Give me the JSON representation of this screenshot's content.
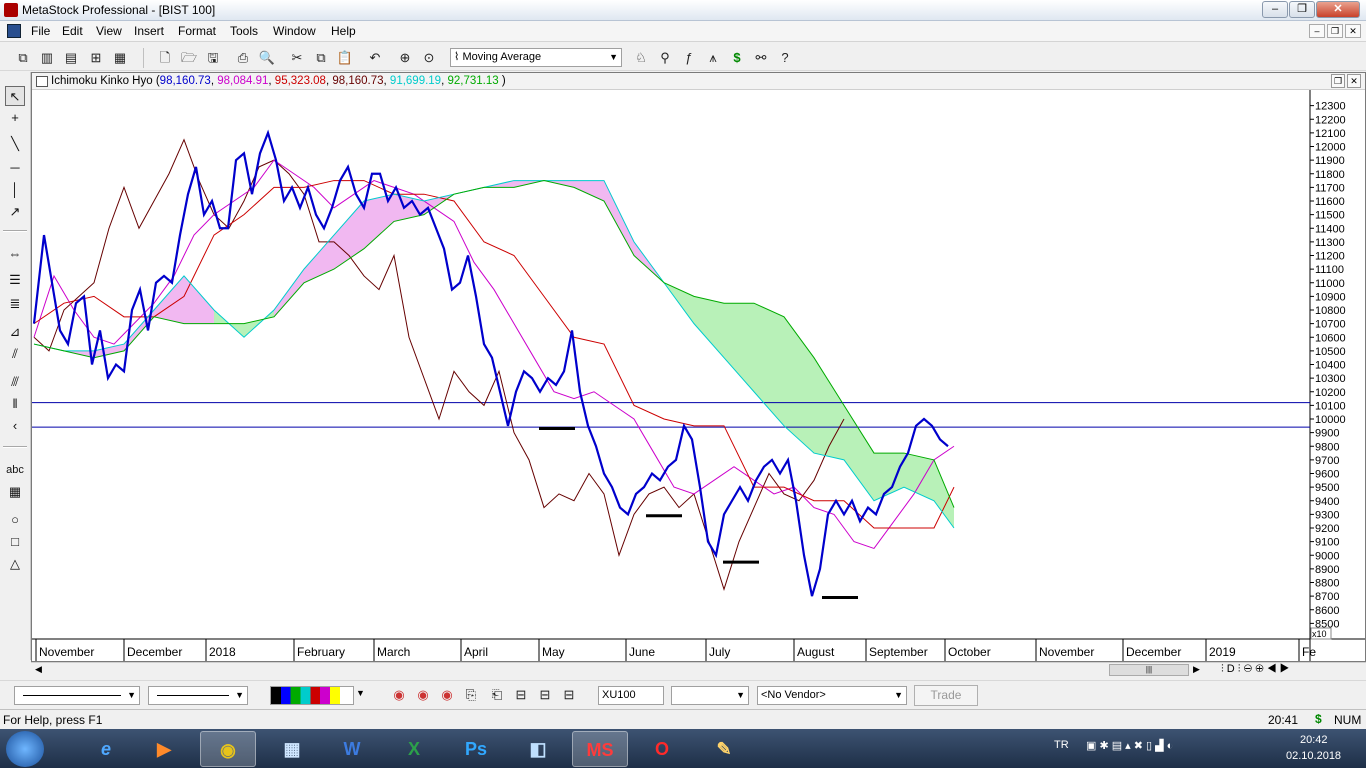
{
  "window": {
    "title": "MetaStock Professional - [BIST 100]",
    "buttons": {
      "minimize": "–",
      "restore": "❐",
      "close": "✕"
    }
  },
  "menu": {
    "items": [
      "File",
      "Edit",
      "View",
      "Insert",
      "Format",
      "Tools",
      "Window",
      "Help"
    ],
    "mdi": {
      "minimize": "–",
      "restore": "❐",
      "close": "✕"
    }
  },
  "toolbar": {
    "indicator_select": "Moving Average"
  },
  "chart": {
    "indicator_name": "Ichimoku Kinko Hyo",
    "values": [
      {
        "text": "98,160.73",
        "color": "#0000cc"
      },
      {
        "text": "98,084.91",
        "color": "#cc00cc"
      },
      {
        "text": "95,323.08",
        "color": "#cc0000"
      },
      {
        "text": "98,160.73",
        "color": "#660000"
      },
      {
        "text": "91,699.19",
        "color": "#00cccc"
      },
      {
        "text": "92,731.13",
        "color": "#00aa00"
      }
    ],
    "scale_label": "x10"
  },
  "chart_data": {
    "type": "line",
    "ylim": [
      8400,
      12400
    ],
    "yticks": [
      8500,
      8600,
      8700,
      8800,
      8900,
      9000,
      9100,
      9200,
      9300,
      9400,
      9500,
      9600,
      9700,
      9800,
      9900,
      10000,
      10100,
      10200,
      10300,
      10400,
      10500,
      10600,
      10700,
      10800,
      10900,
      11000,
      11100,
      11200,
      11300,
      11400,
      11500,
      11600,
      11700,
      11800,
      11900,
      12000,
      12100,
      12200,
      12300
    ],
    "xlabels": [
      "November",
      "December",
      "2018",
      "February",
      "March",
      "April",
      "May",
      "June",
      "July",
      "August",
      "September",
      "October",
      "November",
      "December",
      "2019",
      "Fe"
    ],
    "xlabel_positions": [
      4,
      92,
      174,
      262,
      342,
      429,
      507,
      594,
      674,
      762,
      834,
      913,
      1004,
      1091,
      1174,
      1267
    ],
    "horizontal_lines": [
      10120,
      9940
    ],
    "support_marks": [
      {
        "x": 525,
        "y": 9930
      },
      {
        "x": 632,
        "y": 9290
      },
      {
        "x": 709,
        "y": 8950
      },
      {
        "x": 808,
        "y": 8690
      }
    ],
    "series": [
      {
        "color": "#0000cc",
        "x": [
          0,
          10,
          18,
          26,
          34,
          42,
          50,
          58,
          66,
          74,
          82,
          90,
          98,
          106,
          114,
          122,
          130,
          138,
          146,
          154,
          162,
          170,
          178,
          186,
          194,
          202,
          210,
          218,
          226,
          234,
          242,
          250,
          258,
          266,
          274,
          282,
          290,
          298,
          306,
          314,
          322,
          330,
          338,
          346,
          354,
          362,
          370,
          378,
          386,
          394,
          402,
          410,
          418,
          426,
          434,
          442,
          450,
          458,
          466,
          474,
          482,
          490,
          498,
          506,
          514,
          522,
          530,
          538,
          546,
          554,
          562,
          570,
          578,
          586,
          594,
          602,
          610,
          618,
          626,
          634,
          642,
          650,
          658,
          666,
          674,
          682,
          690,
          698,
          706,
          714,
          722,
          730,
          738,
          746,
          754,
          762,
          770,
          778,
          786,
          794,
          802,
          810,
          818,
          826,
          834,
          842,
          850,
          858,
          866,
          874,
          882,
          890,
          898,
          906,
          914
        ],
        "values": [
          10700,
          11350,
          11000,
          10650,
          10550,
          10850,
          10900,
          10400,
          10650,
          10300,
          10400,
          10350,
          10800,
          10950,
          10650,
          11000,
          11050,
          11000,
          11350,
          11650,
          11850,
          11500,
          11600,
          11400,
          11400,
          11900,
          11950,
          11650,
          11950,
          12100,
          11900,
          11600,
          11700,
          11550,
          11700,
          11500,
          11400,
          11550,
          11750,
          11850,
          11650,
          11550,
          11800,
          11800,
          11600,
          11700,
          11550,
          11600,
          11500,
          11550,
          11400,
          11250,
          10950,
          11000,
          11200,
          10900,
          10550,
          10450,
          10200,
          9950,
          10200,
          10350,
          10300,
          10200,
          10300,
          10250,
          10350,
          10650,
          10200,
          9950,
          9800,
          9600,
          9500,
          9350,
          9300,
          9450,
          9500,
          9600,
          9550,
          9650,
          9700,
          9950,
          9850,
          9500,
          9100,
          9000,
          9300,
          9400,
          9500,
          9400,
          9550,
          9650,
          9700,
          9600,
          9700,
          9400,
          9000,
          8700,
          8900,
          9300,
          9400,
          9300,
          9400,
          9250,
          9350,
          9300,
          9450,
          9500,
          9650,
          9750,
          9950,
          10000,
          9950,
          9850,
          9800
        ]
      },
      {
        "color": "#cc00cc",
        "x": [
          0,
          20,
          40,
          60,
          80,
          100,
          120,
          140,
          160,
          180,
          200,
          220,
          240,
          260,
          280,
          300,
          320,
          340,
          360,
          380,
          400,
          420,
          440,
          460,
          480,
          500,
          520,
          540,
          560,
          580,
          600,
          620,
          640,
          660,
          680,
          700,
          720,
          740,
          760,
          780,
          800,
          820,
          840,
          860,
          880,
          900,
          920
        ],
        "values": [
          10600,
          11050,
          10800,
          10600,
          10550,
          10700,
          10850,
          11050,
          11350,
          11500,
          11600,
          11700,
          11900,
          11800,
          11700,
          11550,
          11650,
          11750,
          11700,
          11650,
          11550,
          11450,
          11150,
          10950,
          10700,
          10450,
          10200,
          10150,
          10200,
          10100,
          10000,
          9750,
          9500,
          9450,
          9550,
          9650,
          9550,
          9450,
          9500,
          9350,
          9300,
          9100,
          9050,
          9250,
          9450,
          9700,
          9800
        ]
      },
      {
        "color": "#cc0000",
        "x": [
          0,
          30,
          60,
          90,
          120,
          150,
          180,
          210,
          240,
          270,
          300,
          330,
          360,
          390,
          420,
          450,
          480,
          510,
          540,
          570,
          600,
          630,
          660,
          690,
          720,
          750,
          780,
          810,
          840,
          870,
          900,
          920
        ],
        "values": [
          10700,
          10850,
          10900,
          10750,
          10750,
          10900,
          11350,
          11500,
          11700,
          11700,
          11750,
          11750,
          11650,
          11650,
          11600,
          11300,
          11200,
          10900,
          10600,
          10550,
          10100,
          10000,
          9950,
          9950,
          9500,
          9500,
          9400,
          9400,
          9200,
          9200,
          9200,
          9500
        ]
      },
      {
        "color": "#660000",
        "x": [
          0,
          15,
          30,
          45,
          60,
          75,
          90,
          105,
          120,
          135,
          150,
          165,
          180,
          195,
          210,
          225,
          240,
          255,
          270,
          285,
          300,
          315,
          330,
          345,
          360,
          375,
          390,
          405,
          420,
          435,
          450,
          465,
          480,
          495,
          510,
          525,
          540,
          555,
          570,
          585,
          600,
          615,
          630,
          645,
          660,
          675,
          690,
          705,
          720,
          735,
          750,
          765,
          780,
          795,
          810
        ],
        "values": [
          10600,
          10500,
          10800,
          10900,
          11000,
          11400,
          11700,
          11400,
          11600,
          11800,
          12050,
          11750,
          11500,
          11400,
          11600,
          11850,
          11900,
          11800,
          11650,
          11300,
          11300,
          11200,
          11050,
          10950,
          11200,
          10600,
          10300,
          10000,
          10350,
          10200,
          10100,
          10350,
          9900,
          9700,
          9350,
          9450,
          9400,
          9600,
          9450,
          9000,
          9300,
          9450,
          9500,
          9350,
          9450,
          9100,
          8750,
          9100,
          9350,
          9600,
          9450,
          9400,
          9550,
          9800,
          10000
        ]
      },
      {
        "color": "#00cccc",
        "x": [
          0,
          30,
          60,
          90,
          120,
          150,
          180,
          210,
          240,
          270,
          300,
          330,
          360,
          390,
          420,
          450,
          480,
          510,
          540,
          570,
          600,
          630,
          660,
          690,
          720,
          750,
          780,
          810,
          840,
          870,
          900,
          920
        ],
        "values": [
          10550,
          10500,
          10500,
          10550,
          10800,
          11050,
          10800,
          10600,
          10800,
          11100,
          11350,
          11600,
          11650,
          11600,
          11650,
          11700,
          11750,
          11750,
          11750,
          11750,
          11300,
          11000,
          10700,
          10450,
          10200,
          9950,
          9750,
          9700,
          9400,
          9500,
          9400,
          9200
        ]
      },
      {
        "color": "#00aa00",
        "x": [
          0,
          30,
          60,
          90,
          120,
          150,
          180,
          210,
          240,
          270,
          300,
          330,
          360,
          390,
          420,
          450,
          480,
          510,
          540,
          570,
          600,
          630,
          660,
          690,
          720,
          750,
          780,
          810,
          840,
          870,
          900,
          920
        ],
        "values": [
          10550,
          10500,
          10450,
          10500,
          10750,
          10700,
          10700,
          10700,
          10750,
          11000,
          11100,
          11250,
          11450,
          11500,
          11650,
          11700,
          11700,
          11750,
          11700,
          11600,
          11200,
          11000,
          10900,
          10850,
          10850,
          10750,
          10450,
          10100,
          9750,
          9750,
          9700,
          9350
        ]
      }
    ],
    "cloud": [
      {
        "x": [
          0,
          30,
          60,
          90,
          120,
          150,
          180,
          210,
          240,
          270,
          300,
          330,
          360,
          390,
          420,
          450,
          480,
          510,
          540,
          570,
          600,
          630,
          660,
          690,
          720,
          750,
          780,
          810,
          840,
          870,
          900,
          920
        ],
        "fill_up": "#00aa00",
        "fill_down": "#cc00cc"
      }
    ],
    "cloud_ref": {
      "a": 4,
      "b": 5
    }
  },
  "bottom": {
    "symbol": "XU100",
    "vendor": "<No Vendor>",
    "trade": "Trade"
  },
  "status": {
    "help": "For Help, press F1",
    "time": "20:41",
    "dollar": "$",
    "num": "NUM"
  },
  "taskbar": {
    "lang": "TR",
    "time": "20:42",
    "date": "02.10.2018"
  }
}
